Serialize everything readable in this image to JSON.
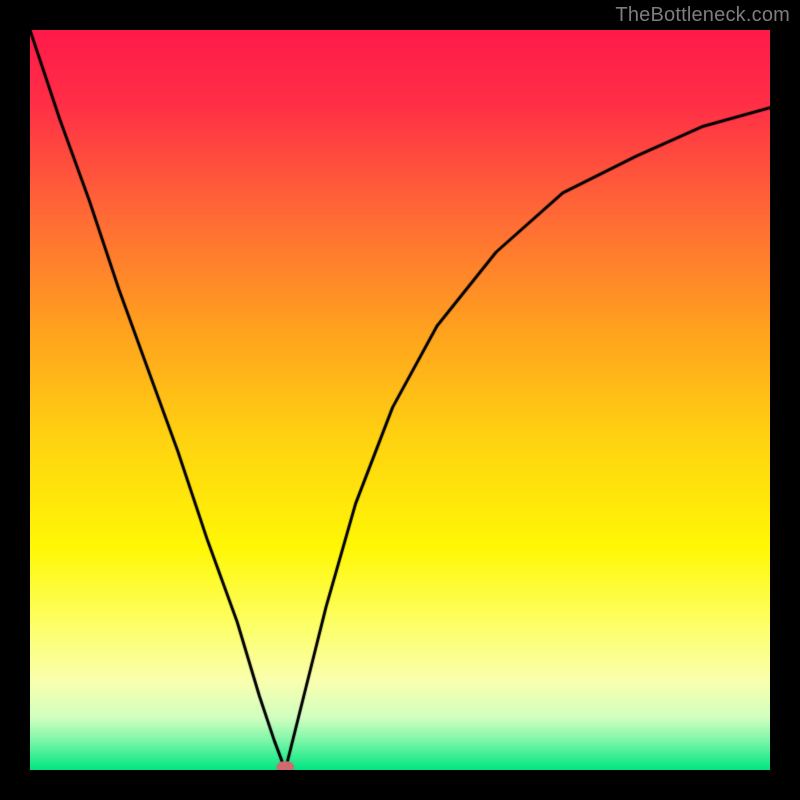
{
  "watermark": {
    "text": "TheBottleneck.com"
  },
  "chart_data": {
    "type": "line",
    "title": "",
    "xlabel": "",
    "ylabel": "",
    "xlim": [
      0,
      1
    ],
    "ylim": [
      0,
      1
    ],
    "background_gradient": {
      "stops": [
        {
          "pos": 0.0,
          "color": "#ff1a4a"
        },
        {
          "pos": 0.1,
          "color": "#ff2f46"
        },
        {
          "pos": 0.25,
          "color": "#ff6a36"
        },
        {
          "pos": 0.4,
          "color": "#ffa01f"
        },
        {
          "pos": 0.55,
          "color": "#ffd211"
        },
        {
          "pos": 0.7,
          "color": "#fff805"
        },
        {
          "pos": 0.8,
          "color": "#fdff63"
        },
        {
          "pos": 0.88,
          "color": "#faffb0"
        },
        {
          "pos": 0.93,
          "color": "#d0ffc0"
        },
        {
          "pos": 0.96,
          "color": "#7df7a8"
        },
        {
          "pos": 1.0,
          "color": "#00e582"
        }
      ]
    },
    "bottleneck_x": 0.345,
    "marker": {
      "color": "#cf6a6e",
      "rx": 9,
      "ry": 6
    },
    "left_curve": {
      "x": [
        0.0,
        0.04,
        0.08,
        0.12,
        0.16,
        0.2,
        0.24,
        0.28,
        0.31,
        0.33,
        0.345
      ],
      "y": [
        1.0,
        0.88,
        0.77,
        0.65,
        0.54,
        0.43,
        0.31,
        0.2,
        0.1,
        0.04,
        0.0
      ]
    },
    "right_curve": {
      "x": [
        0.345,
        0.37,
        0.4,
        0.44,
        0.49,
        0.55,
        0.63,
        0.72,
        0.82,
        0.91,
        1.0
      ],
      "y": [
        0.0,
        0.1,
        0.22,
        0.36,
        0.49,
        0.6,
        0.7,
        0.78,
        0.83,
        0.87,
        0.895
      ]
    }
  }
}
